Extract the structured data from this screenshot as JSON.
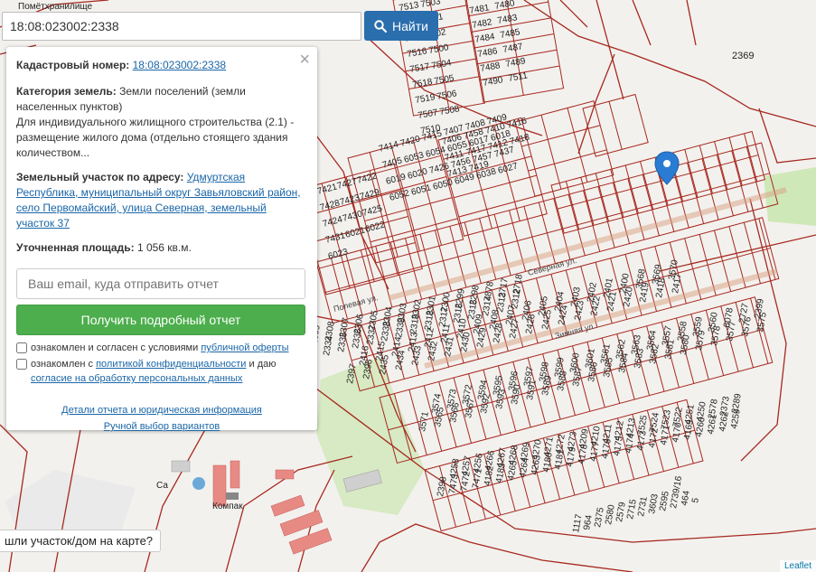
{
  "search": {
    "value": "18:08:023002:2338",
    "button_label": "Найти"
  },
  "panel": {
    "cadastral_label": "Кадастровый номер:",
    "cadastral_value": "18:08:023002:2338",
    "category_label": "Категория земель:",
    "category_value": "Земли поселений (земли населенных пунктов)",
    "usage_text": "Для индивидуального жилищного строительства (2.1) - размещение жилого дома (отдельно стоящего здания количеством...",
    "address_label": "Земельный участок по адресу:",
    "address_value": "Удмуртская Республика, муниципальный округ Завьяловский район, село Первомайский, улица Северная, земельный участок 37",
    "area_label": "Уточненная площадь:",
    "area_value": "1 056 кв.м.",
    "email_placeholder": "Ваш email, куда отправить отчет",
    "report_button": "Получить подробный отчет",
    "consent1_prefix": "ознакомлен и согласен с условиями",
    "consent1_link": "публичной оферты",
    "consent2_prefix": "ознакомлен с",
    "consent2_link1": "политикой конфиденциальности",
    "consent2_mid": "и даю",
    "consent2_link2": "согласие на обработку персональных данных",
    "details_link": "Детали отчета и юридическая информация",
    "manual_link": "Ручной выбор вариантов"
  },
  "map": {
    "top_label": "Помётхранилище",
    "lot_labels": [
      "7513",
      "7503",
      "7514",
      "7501",
      "7515",
      "7502",
      "7516",
      "7500",
      "7517",
      "7504",
      "7518",
      "7505",
      "7519",
      "7506",
      "7507",
      "7508",
      "7510",
      "7481",
      "7480",
      "7482",
      "7483",
      "7484",
      "7485",
      "7486",
      "7487",
      "7488",
      "7489",
      "7490",
      "7511",
      "2369",
      "7406",
      "7458",
      "7410",
      "7416",
      "7411",
      "7417",
      "7412",
      "7418",
      "7413",
      "7419",
      "7414",
      "7420",
      "7415",
      "7407",
      "7408",
      "7409",
      "7405",
      "6053",
      "6054",
      "6055",
      "6017",
      "6018",
      "6019",
      "6020",
      "7426",
      "7456",
      "7457",
      "7437",
      "6052",
      "6051",
      "6050",
      "6049",
      "6038",
      "6027",
      "7421",
      "7427",
      "7422",
      "7428",
      "7423",
      "7429",
      "7424",
      "7430",
      "7425",
      "7431",
      "6021",
      "6022",
      "6023",
      "2321",
      "2322",
      "2323",
      "2324",
      "2334",
      "2335",
      "2336",
      "2337",
      "2338",
      "2339",
      "2319",
      "2318",
      "2317",
      "2316",
      "2315",
      "2314",
      "2313",
      "2312",
      "2311",
      "2310",
      "2309",
      "2308",
      "2307",
      "2306",
      "2305",
      "2304",
      "2303",
      "2302",
      "2301",
      "2300",
      "2299",
      "2298",
      "7878",
      "2717",
      "2718",
      "2397",
      "2396",
      "2435",
      "2434",
      "2433",
      "2432",
      "2431",
      "2430",
      "2429",
      "2428",
      "2427",
      "2426",
      "2425",
      "2424",
      "2423",
      "2422",
      "2421",
      "2420",
      "2419",
      "2418",
      "2417",
      "2416",
      "2415",
      "2414",
      "2413",
      "2412",
      "2411",
      "2410",
      "2409",
      "2408",
      "2407",
      "2406",
      "2405",
      "2404",
      "2403",
      "2402",
      "2401",
      "2400",
      "3568",
      "3569",
      "3570",
      "3571",
      "3565",
      "3566",
      "3567",
      "3592",
      "3593",
      "3590",
      "3591",
      "3589",
      "3588",
      "3587",
      "3586",
      "3585",
      "3584",
      "3583",
      "3582",
      "3581",
      "3580",
      "3579",
      "3578",
      "3577",
      "3576",
      "3575",
      "3574",
      "3573",
      "3572",
      "3594",
      "3595",
      "3596",
      "3597",
      "3598",
      "3599",
      "3600",
      "3601",
      "3561",
      "3562",
      "3563",
      "3564",
      "3557",
      "3558",
      "3559",
      "3560",
      "6078",
      "2727",
      "2399",
      "2398",
      "7473",
      "7472",
      "7471",
      "4182",
      "4183",
      "4265",
      "4264",
      "4263",
      "4180",
      "4181",
      "4179",
      "4178",
      "4177",
      "4176",
      "4175",
      "4174",
      "4173",
      "4172",
      "4171",
      "4170",
      "4169",
      "4260",
      "4261",
      "4262",
      "4259",
      "4258",
      "4257",
      "4256",
      "4266",
      "4267",
      "4268",
      "4269",
      "4270",
      "4271",
      "4272",
      "4273",
      "4209",
      "4210",
      "4211",
      "4212",
      "4213",
      "7525",
      "7524",
      "7523",
      "7522",
      "4251",
      "4250",
      "2578",
      "2373",
      "2289",
      "1117",
      "964",
      "2375",
      "2580",
      "2579",
      "2715",
      "2731",
      "3603",
      "2595",
      "2739/16",
      "464",
      "5"
    ],
    "streets": [
      "Северная ул.",
      "Полевая ул.",
      "Зимняя ул."
    ],
    "poi": {
      "cafe": "Са",
      "company": "Компак"
    }
  },
  "found_button": "шли участок/дом на карте?",
  "attribution": "Leaflet"
}
